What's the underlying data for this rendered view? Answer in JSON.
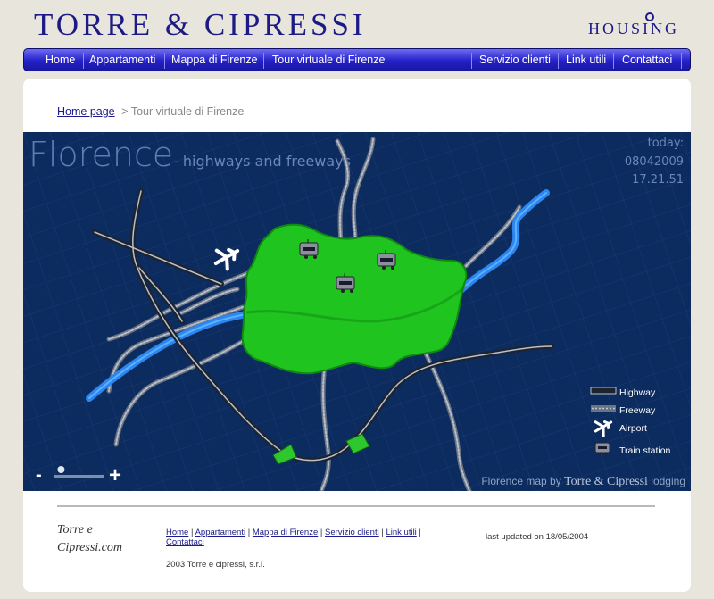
{
  "brand": {
    "name": "TORRE & CIPRESSI",
    "subbrand": "HOUSING"
  },
  "nav": {
    "left": [
      "Home",
      "Appartamenti",
      "Mappa di Firenze",
      "Tour virtuale di Firenze"
    ],
    "right": [
      "Servizio clienti",
      "Link utili",
      "Contattaci"
    ]
  },
  "breadcrumb": {
    "home": "Home page",
    "separator": "->",
    "current": "Tour virtuale di Firenze"
  },
  "map": {
    "title": "Florence",
    "subtitle": "- highways and freeways",
    "today_label": "today:",
    "date": "08042009",
    "time": "17.21.51",
    "legend": [
      "Highway",
      "Freeway",
      "Airport",
      "Train station"
    ],
    "credit_prefix": "Florence map by",
    "credit_brand": "Torre & Cipressi",
    "credit_suffix": "lodging",
    "zoom_minus": "-",
    "zoom_plus": "+",
    "zoom_level": 0.15,
    "colors": {
      "background": "#0c2b5e",
      "city": "#1fc41f",
      "river": "#3b9bff"
    }
  },
  "footer": {
    "logo_line1": "Torre e",
    "logo_line2": "Cipressi.com",
    "links": [
      "Home",
      "Appartamenti",
      "Mappa di Firenze",
      "Servizio clienti",
      "Link utili",
      "Contattaci"
    ],
    "copyright": "2003 Torre e cipressi, s.r.l.",
    "updated": "last updated on 18/05/2004"
  }
}
